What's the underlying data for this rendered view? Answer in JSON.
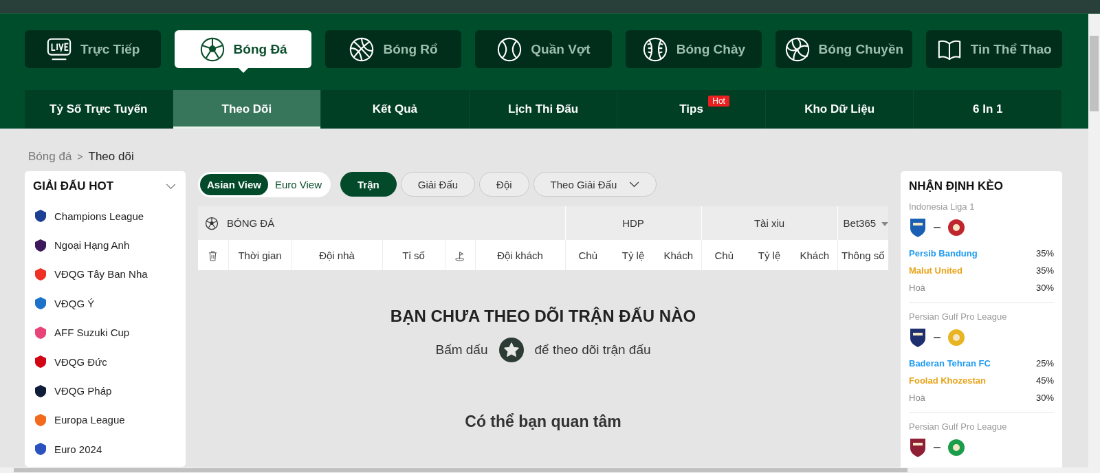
{
  "sports": [
    {
      "label": "Trực Tiếp",
      "selected": false
    },
    {
      "label": "Bóng Đá",
      "selected": true
    },
    {
      "label": "Bóng Rổ",
      "selected": false
    },
    {
      "label": "Quần Vợt",
      "selected": false
    },
    {
      "label": "Bóng Chày",
      "selected": false
    },
    {
      "label": "Bóng Chuyền",
      "selected": false
    },
    {
      "label": "Tin Thể Thao",
      "selected": false
    }
  ],
  "sub_tabs": [
    {
      "label": "Tỷ Số Trực Tuyến",
      "selected": false
    },
    {
      "label": "Theo Dõi",
      "selected": true
    },
    {
      "label": "Kết Quả",
      "selected": false
    },
    {
      "label": "Lịch Thi Đấu",
      "selected": false
    },
    {
      "label": "Tips",
      "selected": false,
      "badge": "Hot"
    },
    {
      "label": "Kho Dữ Liệu",
      "selected": false
    },
    {
      "label": "6 In 1",
      "selected": false
    }
  ],
  "breadcrumb": {
    "items": [
      "Bóng đá",
      "Theo dõi"
    ],
    "separator": ">"
  },
  "sidebar": {
    "title": "GIẢI ĐẤU HOT",
    "expanded": true,
    "items": [
      {
        "label": "Champions League",
        "color": "#1c3f94"
      },
      {
        "label": "Ngoại Hạng Anh",
        "color": "#3d195b"
      },
      {
        "label": "VĐQG Tây Ban Nha",
        "color": "#ee3124"
      },
      {
        "label": "VĐQG Ý",
        "color": "#1d71c9"
      },
      {
        "label": "AFF Suzuki Cup",
        "color": "#e8447a"
      },
      {
        "label": "VĐQG Đức",
        "color": "#d20515"
      },
      {
        "label": "VĐQG Pháp",
        "color": "#0f1d3a"
      },
      {
        "label": "Europa League",
        "color": "#f26b1d"
      },
      {
        "label": "Euro 2024",
        "color": "#2a52be"
      }
    ]
  },
  "view_toggle": [
    {
      "label": "Asian View",
      "selected": true
    },
    {
      "label": "Euro View",
      "selected": false
    }
  ],
  "filters": [
    {
      "label": "Trận",
      "selected": true
    },
    {
      "label": "Giải Đấu",
      "selected": false
    },
    {
      "label": "Đội",
      "selected": false
    },
    {
      "label": "Theo Giải Đấu",
      "selected": false,
      "kind": "dropdown"
    }
  ],
  "table": {
    "group_headers": {
      "sport": "BÓNG ĐÁ",
      "hdp": "HDP",
      "over_under": "Tài xiu",
      "bookmaker": "Bet365"
    },
    "columns": [
      "Thời gian",
      "Đội nhà",
      "Tỉ số",
      "Đội khách",
      "Chủ",
      "Tỷ lệ",
      "Khách",
      "Chủ",
      "Tỷ lệ",
      "Khách",
      "Thông số"
    ]
  },
  "empty_state": {
    "title": "BẠN CHƯA THEO DÕI TRẬN ĐẤU NÀO",
    "hint_before": "Bấm dấu",
    "hint_after": "để theo dõi trận đấu"
  },
  "suggestions_title": "Có thể bạn quan tâm",
  "predictions": {
    "title": "NHẬN ĐỊNH KÈO",
    "items": [
      {
        "league": "Indonesia Liga 1",
        "home": {
          "name": "Persib Bandung",
          "percent": "35%",
          "color": "#1a5fb4"
        },
        "away": {
          "name": "Malut United",
          "percent": "35%",
          "color": "#c0262d"
        },
        "draw": {
          "label": "Hoà",
          "percent": "30%"
        }
      },
      {
        "league": "Persian Gulf Pro League",
        "home": {
          "name": "Baderan Tehran FC",
          "percent": "25%",
          "color": "#1d2f6f"
        },
        "away": {
          "name": "Foolad Khozestan",
          "percent": "45%",
          "color": "#e8b422"
        },
        "draw": {
          "label": "Hoà",
          "percent": "30%"
        }
      },
      {
        "league": "Persian Gulf Pro League",
        "home": {
          "color": "#8e1f34"
        },
        "away": {
          "color": "#1b9e4b"
        }
      }
    ]
  }
}
